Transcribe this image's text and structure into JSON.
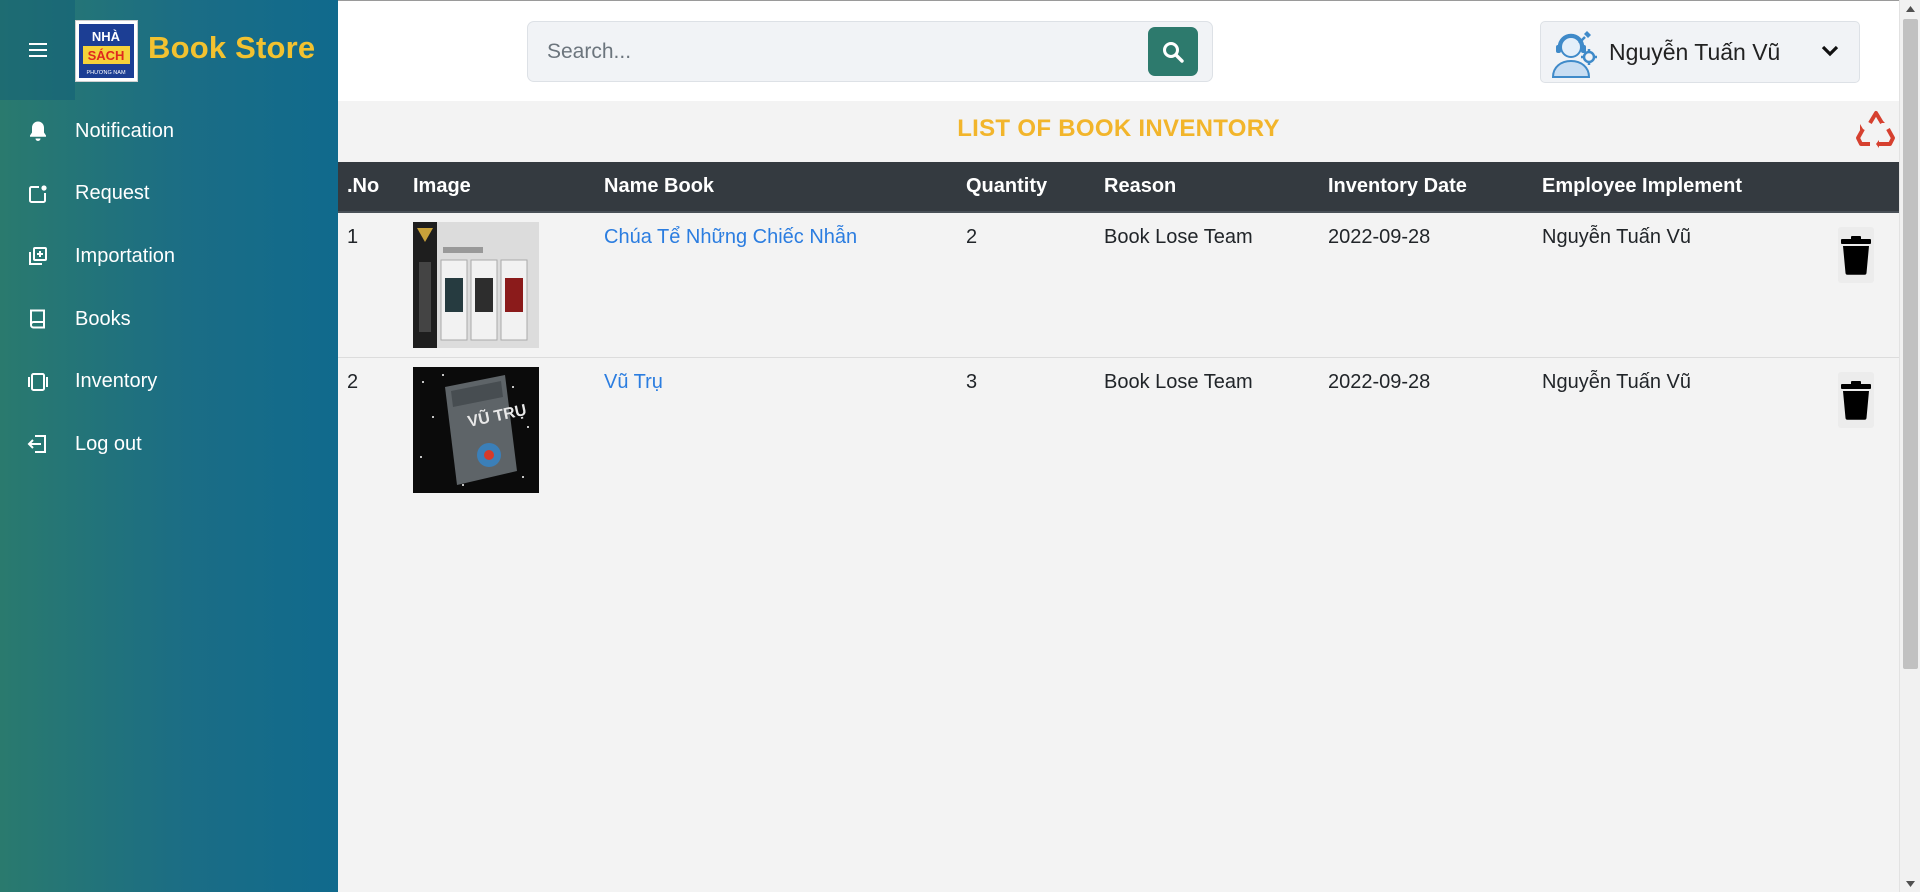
{
  "brand": {
    "logo_lines": [
      "NHÀ",
      "SÁCH",
      "PHƯƠNG NAM"
    ],
    "name": "Book Store",
    "accent_color": "#f2c230"
  },
  "sidebar": {
    "items": [
      {
        "label": "Notification",
        "icon": "bell-icon"
      },
      {
        "label": "Request",
        "icon": "request-icon"
      },
      {
        "label": "Importation",
        "icon": "import-icon"
      },
      {
        "label": "Books",
        "icon": "book-icon"
      },
      {
        "label": "Inventory",
        "icon": "inventory-icon"
      },
      {
        "label": "Log out",
        "icon": "logout-icon"
      }
    ]
  },
  "header": {
    "search": {
      "placeholder": "Search...",
      "value": ""
    },
    "user": {
      "name": "Nguyễn Tuấn Vũ",
      "avatar_icon": "support-agent-icon"
    }
  },
  "page": {
    "title": "LIST OF BOOK INVENTORY",
    "title_color": "#f2b52b"
  },
  "table": {
    "columns": [
      ".No",
      "Image",
      "Name Book",
      "Quantity",
      "Reason",
      "Inventory Date",
      "Employee Implement"
    ],
    "rows": [
      {
        "no": "1",
        "image": "lord-of-the-rings-boxset-cover",
        "name": "Chúa Tể Những Chiếc Nhẫn",
        "quantity": "2",
        "reason": "Book Lose Team",
        "date": "2022-09-28",
        "employee": "Nguyễn Tuấn Vũ"
      },
      {
        "no": "2",
        "image": "vu-tru-book-cover",
        "name": "Vũ Trụ",
        "quantity": "3",
        "reason": "Book Lose Team",
        "date": "2022-09-28",
        "employee": "Nguyễn Tuấn Vũ"
      }
    ]
  }
}
